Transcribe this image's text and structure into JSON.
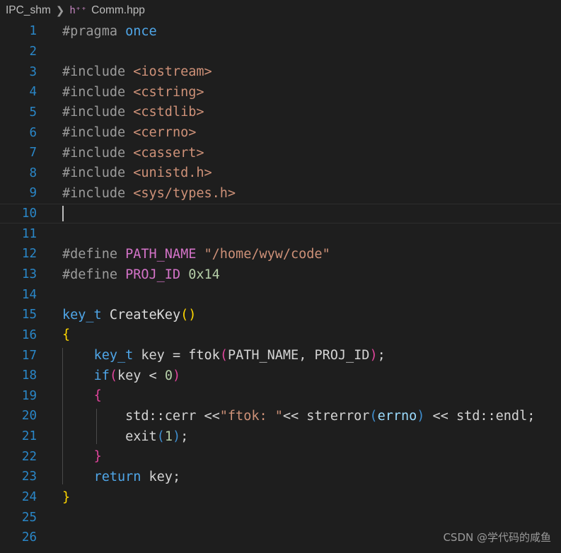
{
  "breadcrumb": {
    "root": "IPC_shm",
    "separator": "❯",
    "file_icon_label": "h⁺⁺",
    "file": "Comm.hpp"
  },
  "editor": {
    "language": "cpp",
    "active_line": 10,
    "cursor": {
      "line": 10,
      "column": 1
    },
    "total_lines": 26,
    "colors": {
      "background": "#1e1e1e",
      "line_number": "#2a87c8",
      "foreground": "#d4d4d4",
      "keyword": "#4fa6e8",
      "string": "#ce9178",
      "macro": "#d473c8",
      "number": "#b5cea8",
      "preprocessor": "#9b9b9b",
      "bracket_yellow": "#ffd700",
      "bracket_pink": "#e0459c",
      "bracket_blue": "#3f8fd0",
      "variable": "#9cdcfe",
      "indent_guide": "#4a4a4a",
      "active_line_border": "#2d2d2d"
    },
    "lines": [
      {
        "n": "1",
        "text": "#pragma once"
      },
      {
        "n": "2",
        "text": ""
      },
      {
        "n": "3",
        "text": "#include <iostream>"
      },
      {
        "n": "4",
        "text": "#include <cstring>"
      },
      {
        "n": "5",
        "text": "#include <cstdlib>"
      },
      {
        "n": "6",
        "text": "#include <cerrno>"
      },
      {
        "n": "7",
        "text": "#include <cassert>"
      },
      {
        "n": "8",
        "text": "#include <unistd.h>"
      },
      {
        "n": "9",
        "text": "#include <sys/types.h>"
      },
      {
        "n": "10",
        "text": ""
      },
      {
        "n": "11",
        "text": ""
      },
      {
        "n": "12",
        "text": "#define PATH_NAME \"/home/wyw/code\""
      },
      {
        "n": "13",
        "text": "#define PROJ_ID 0x14"
      },
      {
        "n": "14",
        "text": ""
      },
      {
        "n": "15",
        "text": "key_t CreateKey()"
      },
      {
        "n": "16",
        "text": "{"
      },
      {
        "n": "17",
        "text": "    key_t key = ftok(PATH_NAME, PROJ_ID);"
      },
      {
        "n": "18",
        "text": "    if(key < 0)"
      },
      {
        "n": "19",
        "text": "    {"
      },
      {
        "n": "20",
        "text": "        std::cerr <<\"ftok: \"<< strerror(errno) << std::endl;"
      },
      {
        "n": "21",
        "text": "        exit(1);"
      },
      {
        "n": "22",
        "text": "    }"
      },
      {
        "n": "23",
        "text": "    return key;"
      },
      {
        "n": "24",
        "text": "}"
      },
      {
        "n": "25",
        "text": ""
      },
      {
        "n": "26",
        "text": ""
      }
    ],
    "tokens": {
      "l1": [
        {
          "t": "#pragma ",
          "c": "t-pre"
        },
        {
          "t": "once",
          "c": "t-kw"
        }
      ],
      "l3": [
        {
          "t": "#include ",
          "c": "t-pre"
        },
        {
          "t": "<iostream>",
          "c": "t-hdr"
        }
      ],
      "l4": [
        {
          "t": "#include ",
          "c": "t-pre"
        },
        {
          "t": "<cstring>",
          "c": "t-hdr"
        }
      ],
      "l5": [
        {
          "t": "#include ",
          "c": "t-pre"
        },
        {
          "t": "<cstdlib>",
          "c": "t-hdr"
        }
      ],
      "l6": [
        {
          "t": "#include ",
          "c": "t-pre"
        },
        {
          "t": "<cerrno>",
          "c": "t-hdr"
        }
      ],
      "l7": [
        {
          "t": "#include ",
          "c": "t-pre"
        },
        {
          "t": "<cassert>",
          "c": "t-hdr"
        }
      ],
      "l8": [
        {
          "t": "#include ",
          "c": "t-pre"
        },
        {
          "t": "<unistd.h>",
          "c": "t-hdr"
        }
      ],
      "l9": [
        {
          "t": "#include ",
          "c": "t-pre"
        },
        {
          "t": "<sys/types.h>",
          "c": "t-hdr"
        }
      ],
      "l12": [
        {
          "t": "#define ",
          "c": "t-pre"
        },
        {
          "t": "PATH_NAME",
          "c": "t-macro"
        },
        {
          "t": " ",
          "c": "t-plain"
        },
        {
          "t": "\"/home/wyw/code\"",
          "c": "t-hdr"
        }
      ],
      "l13": [
        {
          "t": "#define ",
          "c": "t-pre"
        },
        {
          "t": "PROJ_ID",
          "c": "t-macro"
        },
        {
          "t": " ",
          "c": "t-plain"
        },
        {
          "t": "0x14",
          "c": "t-num"
        }
      ],
      "l15": [
        {
          "t": "key_t",
          "c": "t-kw"
        },
        {
          "t": " ",
          "c": "t-plain"
        },
        {
          "t": "CreateKey",
          "c": "t-fn"
        },
        {
          "t": "()",
          "c": "t-br-y"
        }
      ],
      "l16": [
        {
          "t": "{",
          "c": "t-br-y"
        }
      ],
      "l17": [
        {
          "t": "    ",
          "c": "t-plain"
        },
        {
          "t": "key_t",
          "c": "t-kw"
        },
        {
          "t": " key ",
          "c": "t-plain"
        },
        {
          "t": "=",
          "c": "t-op"
        },
        {
          "t": " ",
          "c": "t-plain"
        },
        {
          "t": "ftok",
          "c": "t-fn"
        },
        {
          "t": "(",
          "c": "t-br-p"
        },
        {
          "t": "PATH_NAME, PROJ_ID",
          "c": "t-plain"
        },
        {
          "t": ")",
          "c": "t-br-p"
        },
        {
          "t": ";",
          "c": "t-plain"
        }
      ],
      "l18": [
        {
          "t": "    ",
          "c": "t-plain"
        },
        {
          "t": "if",
          "c": "t-kw"
        },
        {
          "t": "(",
          "c": "t-br-p"
        },
        {
          "t": "key ",
          "c": "t-plain"
        },
        {
          "t": "<",
          "c": "t-op"
        },
        {
          "t": " ",
          "c": "t-plain"
        },
        {
          "t": "0",
          "c": "t-num"
        },
        {
          "t": ")",
          "c": "t-br-p"
        }
      ],
      "l19": [
        {
          "t": "    ",
          "c": "t-plain"
        },
        {
          "t": "{",
          "c": "t-br-p"
        }
      ],
      "l20": [
        {
          "t": "        ",
          "c": "t-plain"
        },
        {
          "t": "std::cerr ",
          "c": "t-plain"
        },
        {
          "t": "<<",
          "c": "t-op"
        },
        {
          "t": "\"ftok: \"",
          "c": "t-hdr"
        },
        {
          "t": "<<",
          "c": "t-op"
        },
        {
          "t": " strerror",
          "c": "t-plain"
        },
        {
          "t": "(",
          "c": "t-br-b"
        },
        {
          "t": "errno",
          "c": "t-var"
        },
        {
          "t": ")",
          "c": "t-br-b"
        },
        {
          "t": " ",
          "c": "t-plain"
        },
        {
          "t": "<<",
          "c": "t-op"
        },
        {
          "t": " std::endl;",
          "c": "t-plain"
        }
      ],
      "l21": [
        {
          "t": "        ",
          "c": "t-plain"
        },
        {
          "t": "exit",
          "c": "t-plain"
        },
        {
          "t": "(",
          "c": "t-br-b"
        },
        {
          "t": "1",
          "c": "t-num"
        },
        {
          "t": ")",
          "c": "t-br-b"
        },
        {
          "t": ";",
          "c": "t-plain"
        }
      ],
      "l22": [
        {
          "t": "    ",
          "c": "t-plain"
        },
        {
          "t": "}",
          "c": "t-br-p"
        }
      ],
      "l23": [
        {
          "t": "    ",
          "c": "t-plain"
        },
        {
          "t": "return",
          "c": "t-kw"
        },
        {
          "t": " key;",
          "c": "t-plain"
        }
      ],
      "l24": [
        {
          "t": "}",
          "c": "t-br-y"
        }
      ]
    }
  },
  "watermark": {
    "text": "CSDN @学代码的咸鱼"
  }
}
